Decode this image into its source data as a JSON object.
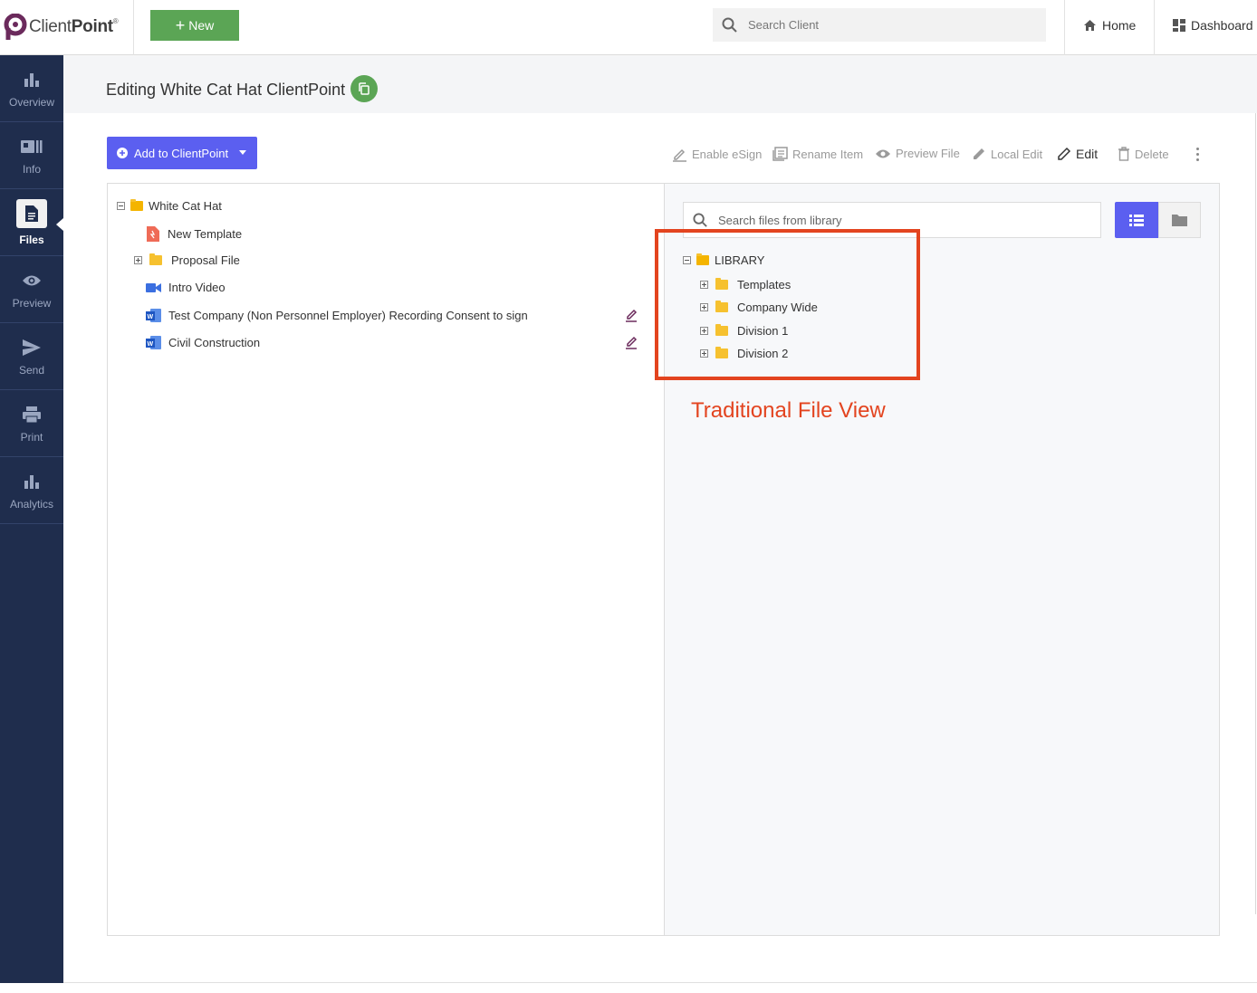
{
  "brand": {
    "name_light": "Client",
    "name_bold": "Point",
    "reg": "®"
  },
  "topbar": {
    "new_label": "New",
    "search_placeholder": "Search Client",
    "home_label": "Home",
    "dashboard_label": "Dashboard"
  },
  "sidebar": {
    "items": [
      {
        "label": "Overview",
        "icon": "bar-chart-icon"
      },
      {
        "label": "Info",
        "icon": "info-card-icon"
      },
      {
        "label": "Files",
        "icon": "document-icon",
        "active": true
      },
      {
        "label": "Preview",
        "icon": "eye-icon"
      },
      {
        "label": "Send",
        "icon": "send-icon"
      },
      {
        "label": "Print",
        "icon": "printer-icon"
      },
      {
        "label": "Analytics",
        "icon": "analytics-icon"
      }
    ]
  },
  "page": {
    "title": "Editing White Cat Hat ClientPoint"
  },
  "toolbar": {
    "add_label": "Add to ClientPoint",
    "enable_esign": "Enable eSign",
    "rename_item": "Rename Item",
    "preview_file": "Preview File",
    "local_edit": "Local Edit",
    "edit": "Edit",
    "delete": "Delete"
  },
  "left_tree": {
    "root": "White Cat Hat",
    "items": [
      {
        "label": "New Template",
        "icon": "pdf-file-icon"
      },
      {
        "label": "Proposal File",
        "icon": "folder-icon"
      },
      {
        "label": "Intro Video",
        "icon": "video-icon"
      },
      {
        "label": "Test Company (Non Personnel Employer) Recording Consent to sign",
        "icon": "word-file-icon"
      },
      {
        "label": "Civil Construction",
        "icon": "word-file-icon"
      }
    ]
  },
  "library": {
    "search_placeholder": "Search files from library",
    "root": "LIBRARY",
    "folders": [
      "Templates",
      "Company Wide",
      "Division 1",
      "Division 2"
    ]
  },
  "annotation": {
    "text": "Traditional File View",
    "color": "#e3441f"
  },
  "colors": {
    "sidebar": "#1f2d4d",
    "accent": "#5b5ff0",
    "green": "#5ba555",
    "folder": "#f6c12f"
  }
}
